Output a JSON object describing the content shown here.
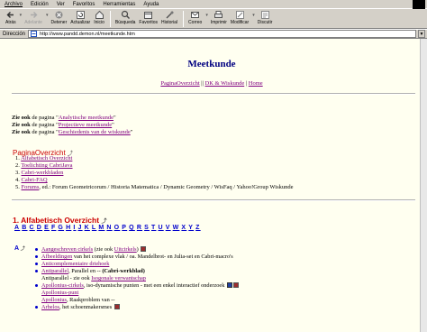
{
  "menu": [
    "Archivo",
    "Edición",
    "Ver",
    "Favoritos",
    "Herramientas",
    "Ayuda"
  ],
  "toolbar": [
    {
      "label": "Atrás",
      "icon": "back-arrow-icon",
      "enabled": true
    },
    {
      "label": "Adelante",
      "icon": "forward-arrow-icon",
      "enabled": false
    },
    {
      "label": "Detener",
      "icon": "stop-icon",
      "enabled": true
    },
    {
      "label": "Actualizar",
      "icon": "refresh-icon",
      "enabled": true
    },
    {
      "label": "Inicio",
      "icon": "home-icon",
      "enabled": true
    },
    {
      "label": "Búsqueda",
      "icon": "search-icon",
      "enabled": true
    },
    {
      "label": "Favoritos",
      "icon": "favorites-icon",
      "enabled": true
    },
    {
      "label": "Historial",
      "icon": "history-icon",
      "enabled": true
    },
    {
      "label": "Correo",
      "icon": "mail-icon",
      "enabled": true
    },
    {
      "label": "Imprimir",
      "icon": "print-icon",
      "enabled": true
    },
    {
      "label": "Modificar",
      "icon": "edit-icon",
      "enabled": true
    },
    {
      "label": "Discutir",
      "icon": "discuss-icon",
      "enabled": true
    }
  ],
  "address": {
    "label": "Dirección",
    "url": "http://www.pandd.demon.nl/meetkunde.htm"
  },
  "page": {
    "title": "Meetkunde",
    "topnav": {
      "link1": "PaginaOverzicht",
      "sep1": "||",
      "link2": "DK & Wiskunde",
      "sep2": "|",
      "link3": "Home"
    },
    "seealso": [
      {
        "prefix": "Zie ook",
        "pre": " de pagina \"",
        "link": "Analytische meetkunde",
        "post": "\""
      },
      {
        "prefix": "Zie ook",
        "pre": " de pagina \"",
        "link": "Projectieve meetkunde",
        "post": "\""
      },
      {
        "prefix": "Zie ook",
        "pre": " de pagina \"",
        "link": "Geschiedenis van de wiskunde",
        "post": "\""
      }
    ],
    "overview_heading": "PaginaOverzicht",
    "toc": [
      {
        "num": "1.",
        "link": "Alfabetisch Overzicht",
        "rest": ""
      },
      {
        "num": "2.",
        "link": "Toelichting CabriJava",
        "rest": ""
      },
      {
        "num": "3.",
        "link": "Cabri-werkbladen",
        "rest": ""
      },
      {
        "num": "4.",
        "link": "Cabri-FAQ",
        "rest": ""
      },
      {
        "num": "5.",
        "link": "Forums",
        "rest": ", ed.: Forum Geometricorum / Historia Matematica / Dynamic Geometry / WisFaq / Yahoo!Group Wiskunde"
      }
    ],
    "alpha_heading": "1. Alfabetisch Overzicht",
    "alphabet": [
      "A",
      "B",
      "C",
      "D",
      "E",
      "F",
      "G",
      "H",
      "I",
      "J",
      "K",
      "L",
      "M",
      "N",
      "O",
      "P",
      "Q",
      "R",
      "S",
      "T",
      "U",
      "V",
      "W",
      "X",
      "Y",
      "Z"
    ],
    "a_letter": "A",
    "a_items": [
      {
        "link": "Aangeschreven cirkels",
        "rest": " (zie ook ",
        "link2": "Uitcirkels",
        "rest2": ")",
        "icon": "doc"
      },
      {
        "link": "Afbeeldingen",
        "rest": " van het complexe vlak / oa. Mandelbrot- en Julia-set en Cabri-macro's",
        "link2": "",
        "rest2": "",
        "icon": ""
      },
      {
        "link": "Anticomplementaire driehoek",
        "rest": "",
        "link2": "",
        "rest2": "",
        "icon": ""
      },
      {
        "link": "Antiparallel",
        "rest": ", Parallel en -- ",
        "bold": "(Cabri-werkblad)",
        "icon": ""
      },
      {
        "sub": true,
        "pre": "Antiparallel - zie ook ",
        "link": "Isogonale verwantschap",
        "rest": ""
      },
      {
        "link": "Apollonius-cirkels",
        "rest": ", iso-dynamische punten - met een enkel interactief onderzoek",
        "icon": "both"
      },
      {
        "sub": true,
        "pre": "",
        "link": "Apollonius-punt",
        "rest": ""
      },
      {
        "sub": true,
        "pre": "",
        "link": "Apollonius",
        "rest": ", Raakproblem van --"
      },
      {
        "link": "Arbelos",
        "rest": ", het schoenmakersmes",
        "icon": "doc"
      }
    ]
  },
  "colors": {
    "link_visited": "#800080",
    "link": "#0000cc",
    "heading_red": "#cc0000",
    "title_blue": "#000080",
    "page_bg": "#fffff0",
    "chrome": "#d4d0c8"
  }
}
